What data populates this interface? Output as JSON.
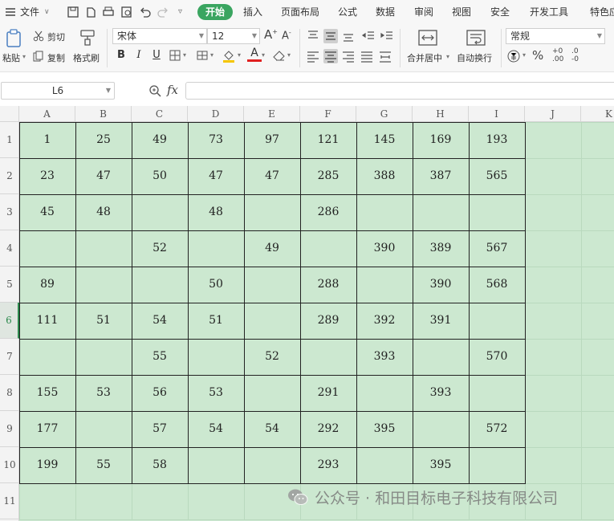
{
  "menu": {
    "file_label": "文件",
    "tabs": [
      "开始",
      "插入",
      "页面布局",
      "公式",
      "数据",
      "审阅",
      "视图",
      "安全",
      "开发工具",
      "特色应"
    ]
  },
  "ribbon": {
    "paste": "粘贴",
    "cut": "剪切",
    "copy": "复制",
    "format_painter": "格式刷",
    "font_name": "宋体",
    "font_size": "12",
    "bold": "B",
    "italic": "I",
    "underline": "U",
    "font_color_letter": "A",
    "merge_center": "合并居中",
    "wrap_text": "自动换行",
    "number_format": "常规",
    "percent": "%",
    "decimal_inc": ".00",
    "decimal_dec": ".0",
    "accent_color": "#3aa560"
  },
  "formula_bar": {
    "cell_ref": "L6",
    "fx": "fx",
    "formula": ""
  },
  "sheet": {
    "columns": [
      "A",
      "B",
      "C",
      "D",
      "E",
      "F",
      "G",
      "H",
      "I",
      "J",
      "K"
    ],
    "rows": [
      "1",
      "2",
      "3",
      "4",
      "5",
      "6",
      "7",
      "8",
      "9",
      "10",
      "11"
    ],
    "selected_row": "6",
    "fill_color": "#cce8d0",
    "cells": [
      [
        "1",
        "25",
        "49",
        "73",
        "97",
        "121",
        "145",
        "169",
        "193"
      ],
      [
        "23",
        "47",
        "50",
        "47",
        "47",
        "285",
        "388",
        "387",
        "565"
      ],
      [
        "45",
        "48",
        "",
        "48",
        "",
        "286",
        "",
        "",
        ""
      ],
      [
        "",
        "",
        "52",
        "",
        "49",
        "",
        "390",
        "389",
        "567"
      ],
      [
        "89",
        "",
        "",
        "50",
        "",
        "288",
        "",
        "390",
        "568"
      ],
      [
        "111",
        "51",
        "54",
        "51",
        "",
        "289",
        "392",
        "391",
        ""
      ],
      [
        "",
        "",
        "55",
        "",
        "52",
        "",
        "393",
        "",
        "570"
      ],
      [
        "155",
        "53",
        "56",
        "53",
        "",
        "291",
        "",
        "393",
        ""
      ],
      [
        "177",
        "",
        "57",
        "54",
        "54",
        "292",
        "395",
        "",
        "572"
      ],
      [
        "199",
        "55",
        "58",
        "",
        "",
        "293",
        "",
        "395",
        ""
      ]
    ]
  },
  "watermark": {
    "text": "公众号 · 和田目标电子科技有限公司"
  }
}
